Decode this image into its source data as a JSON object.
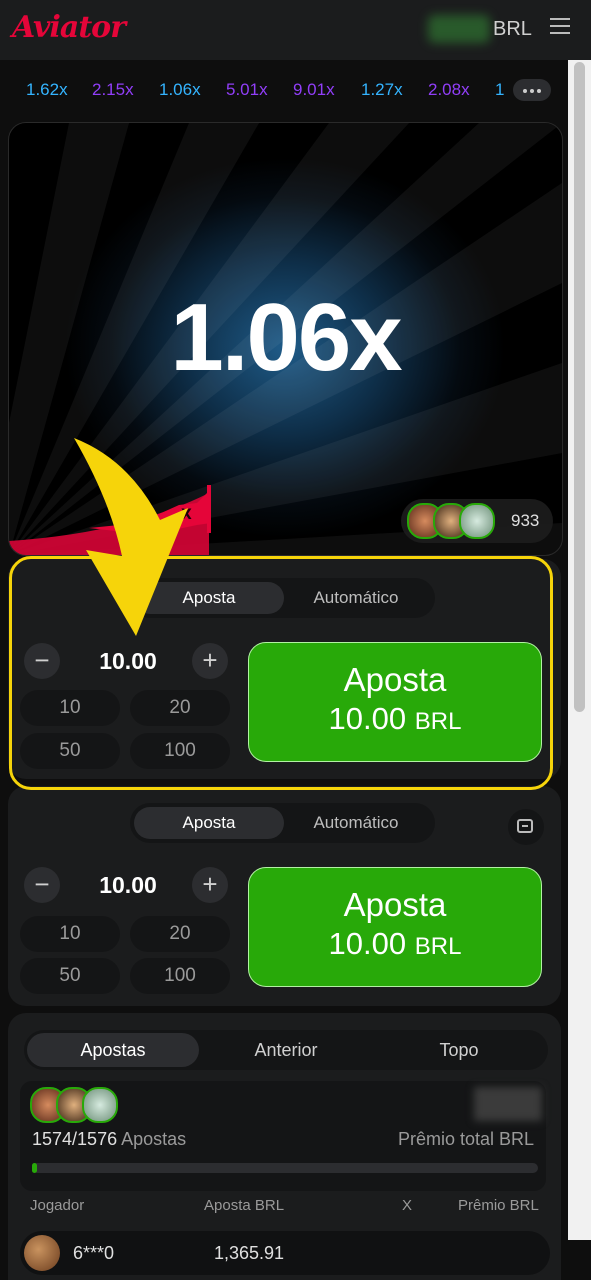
{
  "header": {
    "logo": "Aviator",
    "currency": "BRL"
  },
  "history": [
    {
      "value": "1.62x",
      "color": "#34b4ff"
    },
    {
      "value": "2.15x",
      "color": "#913ef8"
    },
    {
      "value": "1.06x",
      "color": "#34b4ff"
    },
    {
      "value": "5.01x",
      "color": "#913ef8"
    },
    {
      "value": "9.01x",
      "color": "#913ef8"
    },
    {
      "value": "1.27x",
      "color": "#34b4ff"
    },
    {
      "value": "2.08x",
      "color": "#913ef8"
    },
    {
      "value": "1",
      "color": "#34b4ff"
    }
  ],
  "game": {
    "multiplier": "1.06x",
    "players_count": "933",
    "plane_label": "X"
  },
  "bet_panels": [
    {
      "tabs": [
        "Aposta",
        "Automático"
      ],
      "active_tab": "Aposta",
      "amount": "10.00",
      "quick_amounts": [
        "10",
        "20",
        "50",
        "100"
      ],
      "button_title": "Aposta",
      "button_amount": "10.00",
      "button_currency": "BRL"
    },
    {
      "tabs": [
        "Aposta",
        "Automático"
      ],
      "active_tab": "Aposta",
      "amount": "10.00",
      "quick_amounts": [
        "10",
        "20",
        "50",
        "100"
      ],
      "button_title": "Aposta",
      "button_amount": "10.00",
      "button_currency": "BRL"
    }
  ],
  "bets": {
    "tabs": [
      "Apostas",
      "Anterior",
      "Topo"
    ],
    "active_tab": "Apostas",
    "count": "1574/1576",
    "count_label": "Apostas",
    "prize_label": "Prêmio total BRL",
    "progress": 0.01,
    "columns": [
      "Jogador",
      "Aposta BRL",
      "X",
      "Prêmio BRL"
    ],
    "rows": [
      {
        "player": "6***0",
        "bet": "1,365.91"
      }
    ]
  },
  "colors": {
    "accent_red": "#e50539",
    "bet_green": "#28a909",
    "highlight_yellow": "#f6d40a"
  }
}
